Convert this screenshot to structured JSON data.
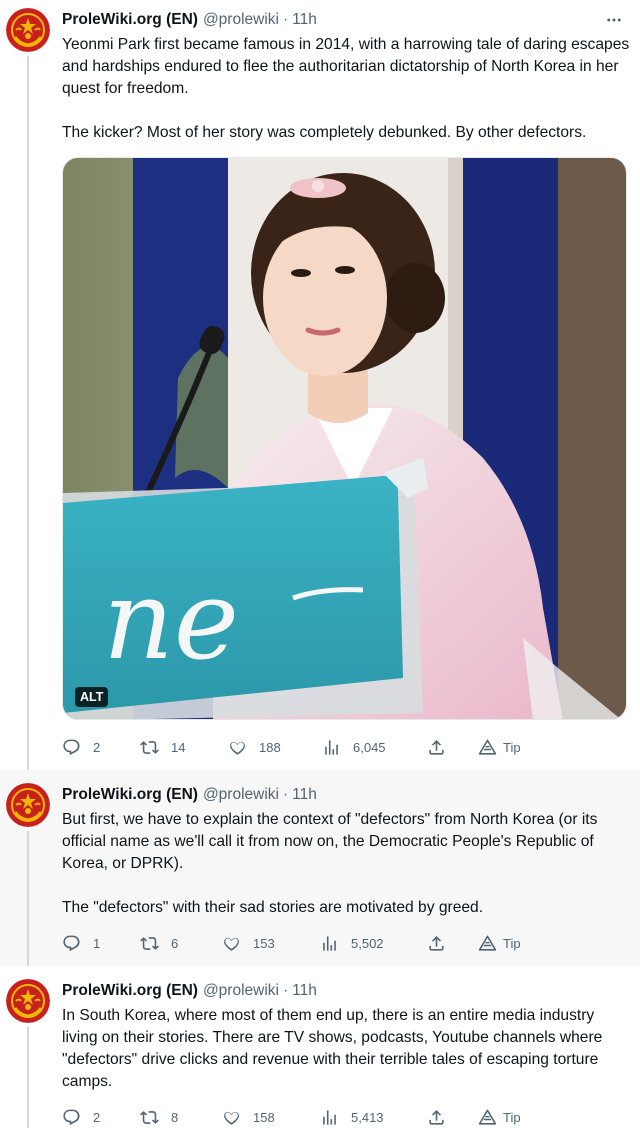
{
  "tweets": [
    {
      "name": "ProleWiki.org (EN)",
      "handle": "@prolewiki",
      "time": "11h",
      "paragraphs": [
        "Yeonmi Park first became famous in 2014, with a harrowing tale of daring escapes and hardships endured to flee the authoritarian dictatorship of North Korea in her quest for freedom.",
        "The kicker? Most of her story was completely debunked. By other defectors."
      ],
      "media_alt_badge": "ALT",
      "replies": "2",
      "retweets": "14",
      "likes": "188",
      "views": "6,045",
      "tip": "Tip"
    },
    {
      "name": "ProleWiki.org (EN)",
      "handle": "@prolewiki",
      "time": "11h",
      "paragraphs": [
        "But first, we have to explain the context of \"defectors\" from North Korea (or its official name as we'll call it from now on, the Democratic People's Republic of Korea, or DPRK).",
        "The \"defectors\" with their sad stories are motivated by greed."
      ],
      "replies": "1",
      "retweets": "6",
      "likes": "153",
      "views": "5,502",
      "tip": "Tip"
    },
    {
      "name": "ProleWiki.org (EN)",
      "handle": "@prolewiki",
      "time": "11h",
      "paragraphs": [
        "In South Korea, where most of them end up, there is an entire media industry living on their stories. There are TV shows, podcasts, Youtube channels where \"defectors\" drive clicks and revenue with their terrible tales of escaping torture camps."
      ],
      "replies": "2",
      "retweets": "8",
      "likes": "158",
      "views": "5,413",
      "tip": "Tip"
    }
  ],
  "colors": {
    "text": "#0f1419",
    "secondary": "#536471",
    "avatar_red": "#c8201c",
    "avatar_gold": "#f2b705",
    "thread_line": "#cfd9de"
  },
  "icons": [
    "more-icon",
    "reply-icon",
    "retweet-icon",
    "like-icon",
    "views-icon",
    "share-icon",
    "tip-icon"
  ]
}
